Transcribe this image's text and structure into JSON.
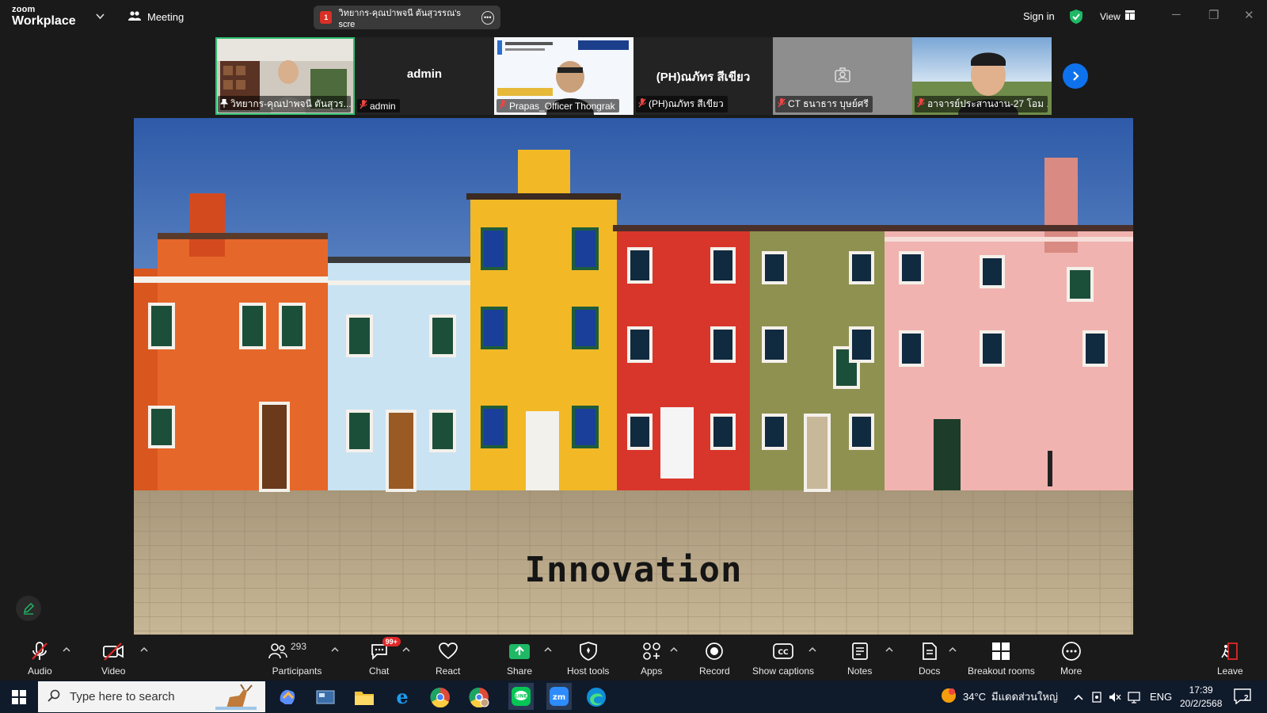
{
  "app": {
    "brand_top": "zoom",
    "brand_bottom": "Workplace",
    "meeting_label": "Meeting"
  },
  "share_pill": {
    "badge": "1",
    "text": "วิทยากร-คุณปาพจนี ตันสุวรรณ's scre"
  },
  "top_right": {
    "sign_in": "Sign in",
    "view": "View"
  },
  "participants": [
    {
      "label": "วิทยากร-คุณปาพจนี ตันสุวร...",
      "big_name": "",
      "kind": "video-person",
      "active": true
    },
    {
      "label": "admin",
      "big_name": "admin",
      "kind": "name"
    },
    {
      "label": "Prapas_Officer Thongrak",
      "big_name": "",
      "kind": "video-slide"
    },
    {
      "label": "(PH)ณภัทร สีเขียว",
      "big_name": "(PH)ณภัทร สีเขียว",
      "kind": "name"
    },
    {
      "label": "CT ธนาธาร บุษย์ศรี",
      "big_name": "",
      "kind": "avatar"
    },
    {
      "label": "อาจารย์ประสานงาน-27 โอม ...",
      "big_name": "",
      "kind": "video-person2"
    }
  ],
  "slide": {
    "caption": "Innovation"
  },
  "toolbar": {
    "audio": "Audio",
    "video": "Video",
    "participants": "Participants",
    "participants_count": "293",
    "chat": "Chat",
    "chat_badge": "99+",
    "react": "React",
    "share": "Share",
    "host_tools": "Host tools",
    "apps": "Apps",
    "record": "Record",
    "captions": "Show captions",
    "notes": "Notes",
    "docs": "Docs",
    "breakout": "Breakout rooms",
    "more": "More",
    "leave": "Leave"
  },
  "taskbar": {
    "search_placeholder": "Type here to search",
    "temp": "34°C",
    "weather": "มีแดดส่วนใหญ่",
    "lang": "ENG",
    "time": "17:39",
    "date": "20/2/2568",
    "notif_count": "2"
  },
  "colors": {
    "accent_blue": "#0e72ed",
    "share_green": "#1fb865",
    "mute_red": "#e02828",
    "active_green": "#2fbf71"
  }
}
